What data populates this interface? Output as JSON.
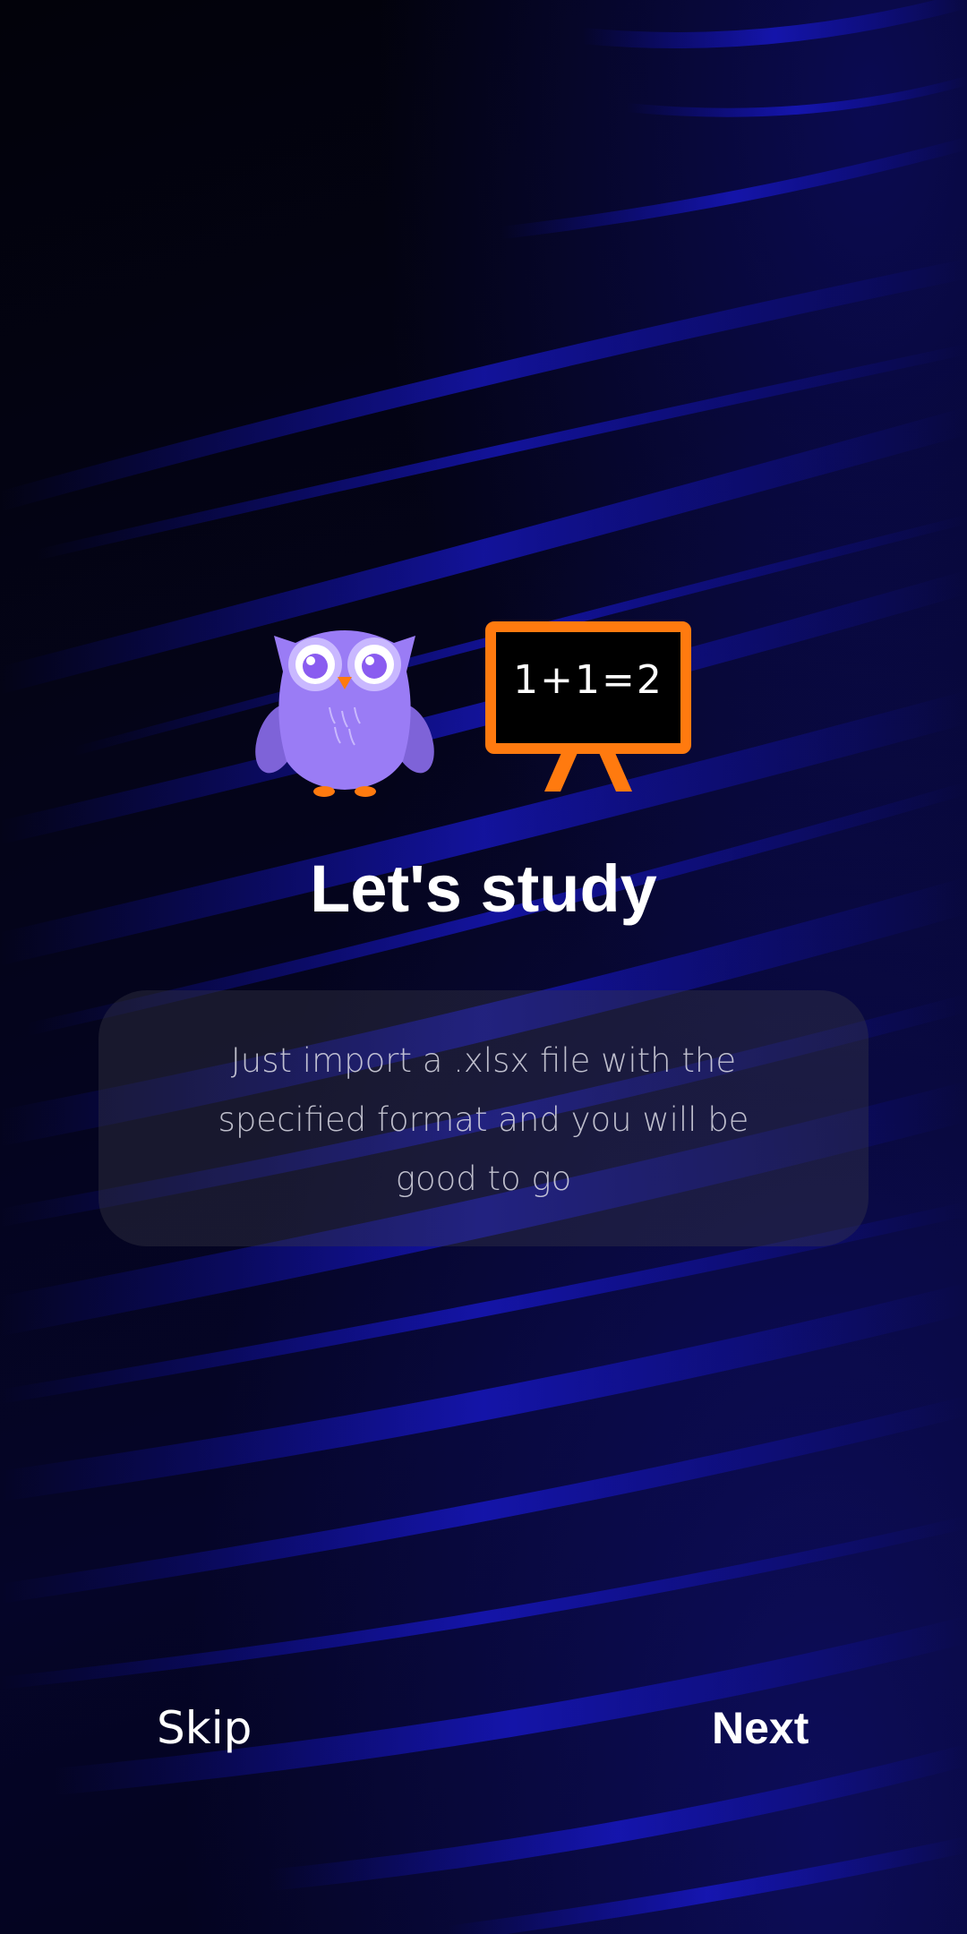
{
  "onboarding": {
    "title": "Let's study",
    "description": "Just import a .xlsx file with the specified format and you will be good to go",
    "illustration": {
      "owl_icon": "owl-mascot-icon",
      "board_icon": "chalkboard-icon",
      "board_text": "1+1=2"
    }
  },
  "actions": {
    "skip_label": "Skip",
    "next_label": "Next"
  },
  "colors": {
    "background": "#03030f",
    "streak_blue": "#1a1aff",
    "owl_purple": "#9a7cf5",
    "board_orange": "#ff7a0f",
    "text": "#ffffff"
  }
}
